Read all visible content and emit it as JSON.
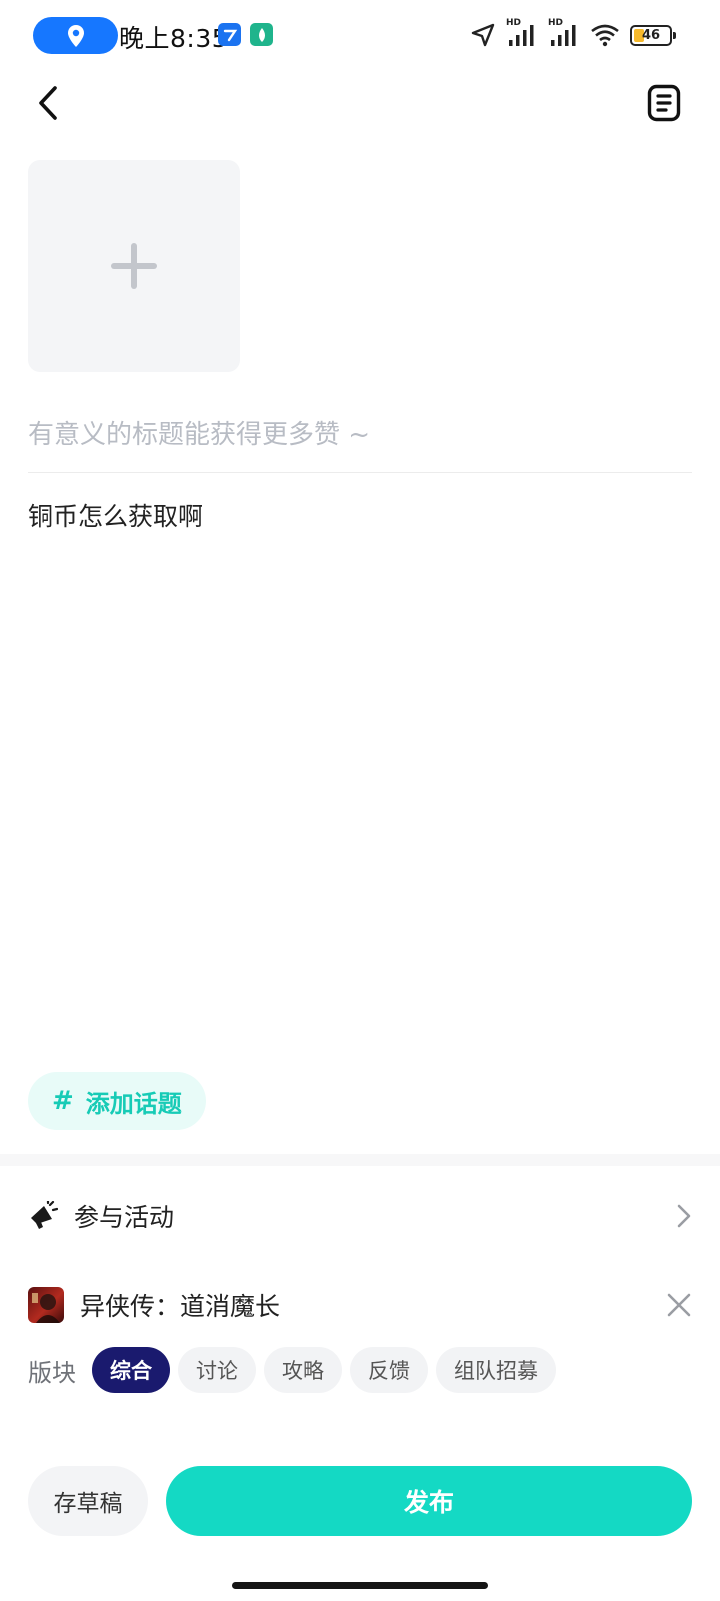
{
  "status_bar": {
    "time": "晚上8:35",
    "battery_level": "46",
    "network_labels": [
      "HD",
      "HD"
    ],
    "location_pill_color": "#1677ff",
    "battery_fill_color": "#f6b92b"
  },
  "header": {
    "back_icon": "chevron-left-icon",
    "drafts_icon": "document-icon"
  },
  "editor": {
    "add_image_icon": "plus-icon",
    "title_placeholder": "有意义的标题能获得更多赞 ~",
    "body_text": "铜币怎么获取啊"
  },
  "topic": {
    "hash": "#",
    "label": "添加话题",
    "color": "#17cbb6"
  },
  "activity": {
    "label": "参与活动",
    "icon": "megaphone-icon"
  },
  "game": {
    "name": "异侠传：道消魔长",
    "close_icon": "close-icon"
  },
  "boards": {
    "label": "版块",
    "selected": "综合",
    "tabs": [
      "综合",
      "讨论",
      "攻略",
      "反馈",
      "组队招募"
    ],
    "active_color": "#1a1a6e"
  },
  "actions": {
    "save_draft": "存草稿",
    "publish": "发布",
    "publish_color": "#14d9c4"
  }
}
